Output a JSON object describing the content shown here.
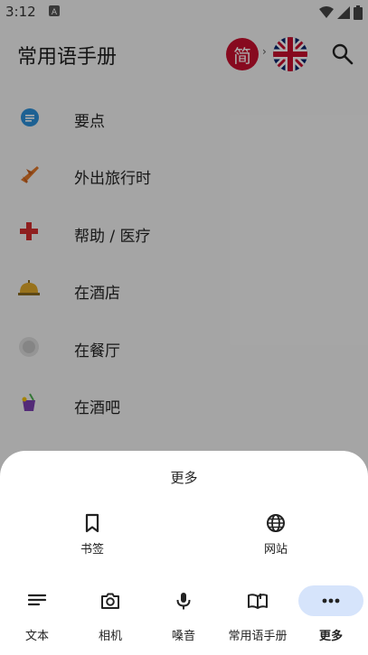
{
  "status": {
    "time": "3:12"
  },
  "app": {
    "title": "常用语手册",
    "source_lang_glyph": "简",
    "arrow": "›"
  },
  "list": [
    {
      "label": "要点",
      "icon": "info-bubble-icon"
    },
    {
      "label": "外出旅行时",
      "icon": "airplane-icon"
    },
    {
      "label": "帮助 / 医疗",
      "icon": "medical-cross-icon"
    },
    {
      "label": "在酒店",
      "icon": "hotel-bell-icon"
    },
    {
      "label": "在餐厅",
      "icon": "plate-icon"
    },
    {
      "label": "在酒吧",
      "icon": "cocktail-icon"
    }
  ],
  "sheet": {
    "title": "更多",
    "options": [
      {
        "label": "书签",
        "icon": "bookmark-icon"
      },
      {
        "label": "网站",
        "icon": "globe-icon"
      }
    ]
  },
  "nav": [
    {
      "label": "文本",
      "icon": "text-lines-icon"
    },
    {
      "label": "相机",
      "icon": "camera-icon"
    },
    {
      "label": "嗓音",
      "icon": "microphone-icon"
    },
    {
      "label": "常用语手册",
      "icon": "phrasebook-icon"
    },
    {
      "label": "更多",
      "icon": "more-dots-icon",
      "active": true
    }
  ],
  "colors": {
    "accent_pill": "#d6e4fb",
    "flag_red": "#c8102e",
    "uk_blue": "#012169"
  }
}
